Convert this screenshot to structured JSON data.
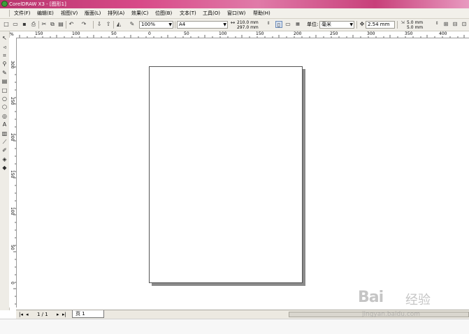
{
  "window": {
    "title": "CorelDRAW X3 - [图形1]"
  },
  "menus": [
    "文件(F)",
    "编辑(E)",
    "视图(V)",
    "版面(L)",
    "排列(A)",
    "效果(C)",
    "位图(B)",
    "文本(T)",
    "工具(O)",
    "窗口(W)",
    "帮助(H)"
  ],
  "toolbar": {
    "zoom": "100%",
    "paper_size": "A4",
    "width": "210.0 mm",
    "height": "297.0 mm",
    "units_label": "单位:",
    "units": "毫米",
    "nudge": "2.54 mm",
    "dup_x": "5.0 mm",
    "dup_y": "5.0 mm"
  },
  "ruler": {
    "unit": "%",
    "h_ticks": [
      "150",
      "100",
      "50",
      "0",
      "50",
      "100",
      "150",
      "200",
      "250",
      "300",
      "350",
      "400"
    ],
    "v_ticks": [
      "300",
      "250",
      "200",
      "150",
      "100",
      "50",
      "0"
    ]
  },
  "status": {
    "page_count": "1 / 1",
    "page_tab": "页 1"
  },
  "watermark": {
    "brand": "Bai",
    "cn": "经验",
    "url": "jingyan.baidu.com"
  },
  "colors": {
    "titlebar": "#c8407a",
    "toolbar_bg": "#f0eee8",
    "page_shadow": "#8a8a8a"
  }
}
